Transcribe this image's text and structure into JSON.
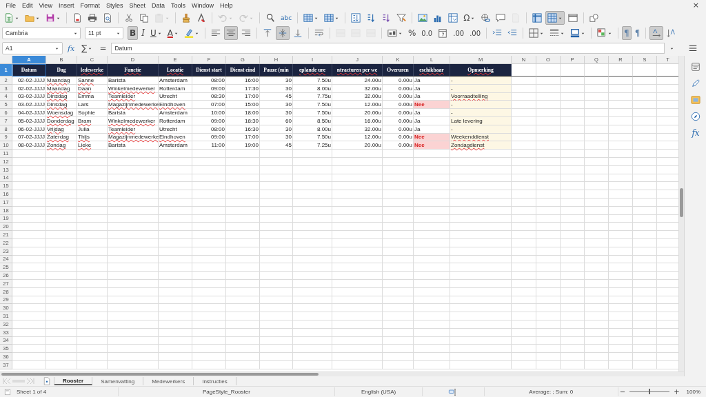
{
  "menu": [
    "File",
    "Edit",
    "View",
    "Insert",
    "Format",
    "Styles",
    "Sheet",
    "Data",
    "Tools",
    "Window",
    "Help"
  ],
  "close_button": "×",
  "toolbar_standard": [
    [
      {
        "kind": "new",
        "dropdown": true
      },
      {
        "kind": "open",
        "dropdown": true
      },
      {
        "kind": "save",
        "dropdown": true
      }
    ],
    [
      {
        "kind": "pdf"
      },
      {
        "kind": "print"
      },
      {
        "kind": "preview"
      }
    ],
    [
      {
        "kind": "cut"
      },
      {
        "kind": "copy"
      },
      {
        "kind": "paste",
        "dropdown": true,
        "disabled": true
      }
    ],
    [
      {
        "kind": "clone"
      },
      {
        "kind": "clear"
      }
    ],
    [
      {
        "kind": "undo",
        "dropdown": true,
        "disabled": true
      },
      {
        "kind": "redo",
        "dropdown": true,
        "disabled": true
      }
    ],
    [
      {
        "kind": "find"
      },
      {
        "kind": "spelling",
        "label": "abc"
      }
    ],
    [
      {
        "kind": "rows",
        "dropdown": true
      },
      {
        "kind": "columns",
        "dropdown": true
      }
    ],
    [
      {
        "kind": "sort"
      },
      {
        "kind": "sort-asc"
      },
      {
        "kind": "sort-desc"
      },
      {
        "kind": "autofilter"
      }
    ],
    [
      {
        "kind": "image"
      },
      {
        "kind": "chart"
      },
      {
        "kind": "pivot"
      },
      {
        "kind": "special-character",
        "label": "Ω",
        "dropdown": true
      },
      {
        "kind": "hyperlink"
      },
      {
        "kind": "comment"
      },
      {
        "kind": "headers-footers",
        "disabled": true
      }
    ],
    [
      {
        "kind": "freeze"
      },
      {
        "kind": "split",
        "on": true,
        "dropdown": true
      },
      {
        "kind": "print-range"
      }
    ],
    [
      {
        "kind": "shapes"
      }
    ]
  ],
  "font_name": "Cambria",
  "font_size": "11 pt",
  "toolbar_formatting": [
    [
      {
        "kind": "bold",
        "label": "B",
        "on": true
      },
      {
        "kind": "italic",
        "label": "I"
      },
      {
        "kind": "underline",
        "label": "U",
        "dropdown": true
      },
      {
        "kind": "font-color",
        "label": "A",
        "dropdown": true
      },
      {
        "kind": "highlight",
        "dropdown": true
      }
    ],
    [
      {
        "kind": "align-left"
      },
      {
        "kind": "align-center",
        "on": true
      },
      {
        "kind": "align-right"
      }
    ],
    [
      {
        "kind": "align-top"
      },
      {
        "kind": "align-middle",
        "on": true
      },
      {
        "kind": "align-bottom"
      }
    ],
    [
      {
        "kind": "wrap"
      }
    ],
    [
      {
        "kind": "merge-center",
        "disabled": true
      },
      {
        "kind": "merge",
        "disabled": true
      },
      {
        "kind": "unmerge",
        "disabled": true
      }
    ],
    [
      {
        "kind": "number-format",
        "dropdown": true
      },
      {
        "kind": "percent",
        "label": "%"
      },
      {
        "kind": "decimal",
        "label": "0.0"
      },
      {
        "kind": "date"
      },
      {
        "kind": "add-decimal",
        "label": ".00"
      },
      {
        "kind": "remove-decimal",
        "label": ".00"
      }
    ],
    [
      {
        "kind": "indent-increase"
      },
      {
        "kind": "indent-decrease"
      }
    ],
    [
      {
        "kind": "borders",
        "dropdown": true
      },
      {
        "kind": "border-style",
        "dropdown": true
      },
      {
        "kind": "border-color",
        "dropdown": true
      }
    ],
    [
      {
        "kind": "conditional",
        "dropdown": true
      }
    ],
    [
      {
        "kind": "left-to-right",
        "label": "¶",
        "on": true
      },
      {
        "kind": "right-to-left",
        "label": "¶"
      }
    ],
    [
      {
        "kind": "text-horizontal",
        "on": true
      },
      {
        "kind": "text-vertical"
      }
    ]
  ],
  "formula_bar": {
    "cell_reference": "A1",
    "function_wizard": "fx",
    "sum": "∑",
    "formula": "=",
    "content": "Datum"
  },
  "columns": [
    {
      "letter": "A",
      "selected": true
    },
    {
      "letter": "B",
      "selected": false
    },
    {
      "letter": "C",
      "selected": false
    },
    {
      "letter": "D",
      "selected": false
    },
    {
      "letter": "E",
      "selected": false
    },
    {
      "letter": "F",
      "selected": false
    },
    {
      "letter": "G",
      "selected": false
    },
    {
      "letter": "H",
      "selected": false
    },
    {
      "letter": "I",
      "selected": false
    },
    {
      "letter": "J",
      "selected": false
    },
    {
      "letter": "K",
      "selected": false
    },
    {
      "letter": "L",
      "selected": false
    },
    {
      "letter": "M",
      "selected": false
    },
    {
      "letter": "N",
      "selected": false
    },
    {
      "letter": "O",
      "selected": false
    },
    {
      "letter": "P",
      "selected": false
    },
    {
      "letter": "Q",
      "selected": false
    },
    {
      "letter": "R",
      "selected": false
    },
    {
      "letter": "S",
      "selected": false
    },
    {
      "letter": "T",
      "selected": false
    }
  ],
  "rows": [
    {
      "number": "1",
      "selected": true,
      "kind": "header",
      "cells": [
        {
          "text": "Datum",
          "misspelled": false
        },
        {
          "text": "Dag",
          "misspelled": false
        },
        {
          "text": "ledewerke",
          "misspelled": true
        },
        {
          "text": "Functie",
          "misspelled": true
        },
        {
          "text": "Locatie",
          "misspelled": true
        },
        {
          "text": "Dienst start",
          "misspelled": false
        },
        {
          "text": "Dienst eind",
          "misspelled": false
        },
        {
          "text": "Pauze (min",
          "misspelled": false
        },
        {
          "text": "eplande ure",
          "misspelled": true
        },
        {
          "text": "ntracturen per we",
          "misspelled": true
        },
        {
          "text": "Overuren",
          "misspelled": false
        },
        {
          "text": "eschikbaar",
          "misspelled": true
        },
        {
          "text": "Opmerking",
          "misspelled": true
        }
      ]
    },
    {
      "number": "2",
      "selected": false,
      "kind": "data",
      "cells": [
        {
          "text": "02-02-JJJJ",
          "misspelled": false
        },
        {
          "text": "Maandag",
          "misspelled": true
        },
        {
          "text": "Sanne",
          "misspelled": true
        },
        {
          "text": "Barista",
          "misspelled": false
        },
        {
          "text": "Amsterdam",
          "misspelled": false
        },
        {
          "text": "08:00",
          "misspelled": false
        },
        {
          "text": "16:00",
          "misspelled": false
        },
        {
          "text": "30",
          "misspelled": false
        },
        {
          "text": "7.50u",
          "misspelled": false
        },
        {
          "text": "24.00u",
          "misspelled": false
        },
        {
          "text": "0.00u",
          "misspelled": false
        },
        {
          "text": "Ja",
          "misspelled": false,
          "flagged": false
        },
        {
          "text": "-",
          "misspelled": false
        }
      ]
    },
    {
      "number": "3",
      "selected": false,
      "kind": "data",
      "cells": [
        {
          "text": "02-02-JJJJ",
          "misspelled": false
        },
        {
          "text": "Maandag",
          "misspelled": true
        },
        {
          "text": "Daan",
          "misspelled": true
        },
        {
          "text": "Winkelmedewerker",
          "misspelled": true
        },
        {
          "text": "Rotterdam",
          "misspelled": false
        },
        {
          "text": "09:00",
          "misspelled": false
        },
        {
          "text": "17:30",
          "misspelled": false
        },
        {
          "text": "30",
          "misspelled": false
        },
        {
          "text": "8.00u",
          "misspelled": false
        },
        {
          "text": "32.00u",
          "misspelled": false
        },
        {
          "text": "0.00u",
          "misspelled": false
        },
        {
          "text": "Ja",
          "misspelled": false,
          "flagged": false
        },
        {
          "text": "-",
          "misspelled": false
        }
      ]
    },
    {
      "number": "4",
      "selected": false,
      "kind": "data",
      "cells": [
        {
          "text": "03-02-JJJJ",
          "misspelled": false
        },
        {
          "text": "Dinsdag",
          "misspelled": true
        },
        {
          "text": "Emma",
          "misspelled": false
        },
        {
          "text": "Teamleider",
          "misspelled": true
        },
        {
          "text": "Utrecht",
          "misspelled": false
        },
        {
          "text": "08:30",
          "misspelled": false
        },
        {
          "text": "17:00",
          "misspelled": false
        },
        {
          "text": "45",
          "misspelled": false
        },
        {
          "text": "7.75u",
          "misspelled": false
        },
        {
          "text": "32.00u",
          "misspelled": false
        },
        {
          "text": "0.00u",
          "misspelled": false
        },
        {
          "text": "Ja",
          "misspelled": false,
          "flagged": false
        },
        {
          "text": "Voorraadtelling",
          "misspelled": true
        }
      ]
    },
    {
      "number": "5",
      "selected": false,
      "kind": "data",
      "cells": [
        {
          "text": "03-02-JJJJ",
          "misspelled": false
        },
        {
          "text": "Dinsdag",
          "misspelled": true
        },
        {
          "text": "Lars",
          "misspelled": false
        },
        {
          "text": "Magazijnmedewerke",
          "misspelled": true
        },
        {
          "text": "Eindhoven",
          "misspelled": true
        },
        {
          "text": "07:00",
          "misspelled": false
        },
        {
          "text": "15:00",
          "misspelled": false
        },
        {
          "text": "30",
          "misspelled": false
        },
        {
          "text": "7.50u",
          "misspelled": false
        },
        {
          "text": "12.00u",
          "misspelled": false
        },
        {
          "text": "0.00u",
          "misspelled": false
        },
        {
          "text": "Nee",
          "misspelled": false,
          "flagged": true
        },
        {
          "text": "-",
          "misspelled": false
        }
      ]
    },
    {
      "number": "6",
      "selected": false,
      "kind": "data",
      "cells": [
        {
          "text": "04-02-JJJJ",
          "misspelled": false
        },
        {
          "text": "Woensdag",
          "misspelled": true
        },
        {
          "text": "Sophie",
          "misspelled": false
        },
        {
          "text": "Barista",
          "misspelled": false
        },
        {
          "text": "Amsterdam",
          "misspelled": false
        },
        {
          "text": "10:00",
          "misspelled": false
        },
        {
          "text": "18:00",
          "misspelled": false
        },
        {
          "text": "30",
          "misspelled": false
        },
        {
          "text": "7.50u",
          "misspelled": false
        },
        {
          "text": "20.00u",
          "misspelled": false
        },
        {
          "text": "0.00u",
          "misspelled": false
        },
        {
          "text": "Ja",
          "misspelled": false,
          "flagged": false
        },
        {
          "text": "-",
          "misspelled": false
        }
      ]
    },
    {
      "number": "7",
      "selected": false,
      "kind": "data",
      "cells": [
        {
          "text": "05-02-JJJJ",
          "misspelled": false
        },
        {
          "text": "Donderdag",
          "misspelled": true
        },
        {
          "text": "Bram",
          "misspelled": true
        },
        {
          "text": "Winkelmedewerker",
          "misspelled": true
        },
        {
          "text": "Rotterdam",
          "misspelled": false
        },
        {
          "text": "09:00",
          "misspelled": false
        },
        {
          "text": "18:30",
          "misspelled": false
        },
        {
          "text": "60",
          "misspelled": false
        },
        {
          "text": "8.50u",
          "misspelled": false
        },
        {
          "text": "16.00u",
          "misspelled": false
        },
        {
          "text": "0.00u",
          "misspelled": false
        },
        {
          "text": "Ja",
          "misspelled": false,
          "flagged": false
        },
        {
          "text": "Late levering",
          "misspelled": false
        }
      ]
    },
    {
      "number": "8",
      "selected": false,
      "kind": "data",
      "cells": [
        {
          "text": "06-02-JJJJ",
          "misspelled": false
        },
        {
          "text": "Vrijdag",
          "misspelled": true
        },
        {
          "text": "Julia",
          "misspelled": false
        },
        {
          "text": "Teamleider",
          "misspelled": true
        },
        {
          "text": "Utrecht",
          "misspelled": false
        },
        {
          "text": "08:00",
          "misspelled": false
        },
        {
          "text": "16:30",
          "misspelled": false
        },
        {
          "text": "30",
          "misspelled": false
        },
        {
          "text": "8.00u",
          "misspelled": false
        },
        {
          "text": "32.00u",
          "misspelled": false
        },
        {
          "text": "0.00u",
          "misspelled": false
        },
        {
          "text": "Ja",
          "misspelled": false,
          "flagged": false
        },
        {
          "text": "-",
          "misspelled": false
        }
      ]
    },
    {
      "number": "9",
      "selected": false,
      "kind": "data",
      "cells": [
        {
          "text": "07-02-JJJJ",
          "misspelled": false
        },
        {
          "text": "Zaterdag",
          "misspelled": true
        },
        {
          "text": "Thijs",
          "misspelled": true
        },
        {
          "text": "Magazijnmedewerke",
          "misspelled": true
        },
        {
          "text": "Eindhoven",
          "misspelled": true
        },
        {
          "text": "09:00",
          "misspelled": false
        },
        {
          "text": "17:00",
          "misspelled": false
        },
        {
          "text": "30",
          "misspelled": false
        },
        {
          "text": "7.50u",
          "misspelled": false
        },
        {
          "text": "12.00u",
          "misspelled": false
        },
        {
          "text": "0.00u",
          "misspelled": false
        },
        {
          "text": "Nee",
          "misspelled": false,
          "flagged": true
        },
        {
          "text": "Weekenddienst",
          "misspelled": true
        }
      ]
    },
    {
      "number": "10",
      "selected": false,
      "kind": "data",
      "cells": [
        {
          "text": "08-02-JJJJ",
          "misspelled": false
        },
        {
          "text": "Zondag",
          "misspelled": true
        },
        {
          "text": "Lieke",
          "misspelled": true
        },
        {
          "text": "Barista",
          "misspelled": false
        },
        {
          "text": "Amsterdam",
          "misspelled": false
        },
        {
          "text": "11:00",
          "misspelled": false
        },
        {
          "text": "19:00",
          "misspelled": false
        },
        {
          "text": "45",
          "misspelled": false
        },
        {
          "text": "7.25u",
          "misspelled": false
        },
        {
          "text": "20.00u",
          "misspelled": false
        },
        {
          "text": "0.00u",
          "misspelled": false
        },
        {
          "text": "Nee",
          "misspelled": false,
          "flagged": true
        },
        {
          "text": "Zondagdienst",
          "misspelled": true
        }
      ]
    },
    {
      "number": "11",
      "selected": false,
      "kind": "empty"
    },
    {
      "number": "12",
      "selected": false,
      "kind": "empty"
    },
    {
      "number": "13",
      "selected": false,
      "kind": "empty"
    },
    {
      "number": "14",
      "selected": false,
      "kind": "empty"
    },
    {
      "number": "15",
      "selected": false,
      "kind": "empty"
    },
    {
      "number": "16",
      "selected": false,
      "kind": "empty"
    },
    {
      "number": "17",
      "selected": false,
      "kind": "empty"
    },
    {
      "number": "18",
      "selected": false,
      "kind": "empty"
    },
    {
      "number": "19",
      "selected": false,
      "kind": "empty"
    },
    {
      "number": "20",
      "selected": false,
      "kind": "empty"
    },
    {
      "number": "21",
      "selected": false,
      "kind": "empty"
    },
    {
      "number": "22",
      "selected": false,
      "kind": "empty"
    },
    {
      "number": "23",
      "selected": false,
      "kind": "empty"
    },
    {
      "number": "24",
      "selected": false,
      "kind": "empty"
    },
    {
      "number": "25",
      "selected": false,
      "kind": "empty"
    },
    {
      "number": "26",
      "selected": false,
      "kind": "empty"
    },
    {
      "number": "27",
      "selected": false,
      "kind": "empty"
    },
    {
      "number": "28",
      "selected": false,
      "kind": "empty"
    },
    {
      "number": "29",
      "selected": false,
      "kind": "empty"
    },
    {
      "number": "30",
      "selected": false,
      "kind": "empty"
    },
    {
      "number": "31",
      "selected": false,
      "kind": "empty"
    },
    {
      "number": "32",
      "selected": false,
      "kind": "empty"
    },
    {
      "number": "33",
      "selected": false,
      "kind": "empty"
    },
    {
      "number": "34",
      "selected": false,
      "kind": "empty"
    },
    {
      "number": "35",
      "selected": false,
      "kind": "empty"
    },
    {
      "number": "36",
      "selected": false,
      "kind": "empty"
    },
    {
      "number": "37",
      "selected": false,
      "kind": "empty"
    }
  ],
  "sheet_tabs": [
    {
      "label": "Rooster",
      "selected": true
    },
    {
      "label": "Samenvatting",
      "selected": false
    },
    {
      "label": "Medewerkers",
      "selected": false
    },
    {
      "label": "Instructies",
      "selected": false
    }
  ],
  "status_bar": {
    "sheet": "Sheet 1 of 4",
    "page_style": "PageStyle_Rooster",
    "language": "English (USA)",
    "selection_summary": "Average: ; Sum: 0",
    "zoom_out": "−",
    "zoom_slider": {
      "level": 0.5
    },
    "zoom_in": "+",
    "zoom": "100%"
  },
  "sidebar": [
    {
      "kind": "properties"
    },
    {
      "kind": "styles"
    },
    {
      "kind": "gallery"
    },
    {
      "kind": "navigator"
    },
    {
      "kind": "functions",
      "label": "fx"
    }
  ]
}
